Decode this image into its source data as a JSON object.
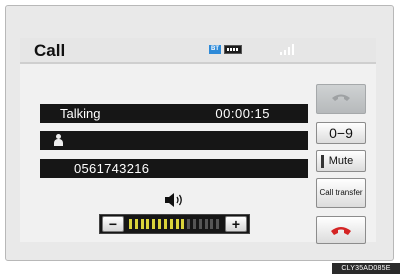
{
  "header": {
    "title": "Call",
    "bluetooth_badge": "BT"
  },
  "call": {
    "status": "Talking",
    "duration": "00:00:15",
    "number": "0561743216"
  },
  "volume": {
    "level": 0.6,
    "segments_total": 16,
    "segments_on": 10,
    "minus": "−",
    "plus": "+"
  },
  "side_buttons": {
    "keypad_label": "0−9",
    "mute_label": "Mute",
    "transfer_label": "Call transfer"
  },
  "icons": {
    "answer": "phone-off-hook-icon",
    "hangup": "phone-hang-up-icon",
    "person": "person-icon",
    "speaker": "speaker-icon",
    "bluetooth": "bluetooth-icon",
    "battery": "battery-icon",
    "signal": "signal-strength-icon"
  },
  "colors": {
    "bar_bg": "#161616",
    "volume_on": "#d9d33a",
    "volume_off": "#555555",
    "hangup_red": "#d42424",
    "bluetooth_blue": "#2e8ad8"
  },
  "caption": "CLY35AD085E"
}
